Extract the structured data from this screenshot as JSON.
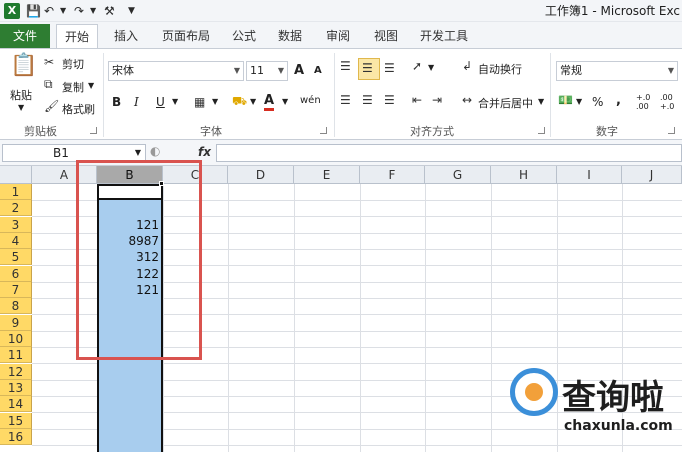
{
  "window": {
    "title": "工作簿1 - Microsoft Exc",
    "app_icon": "X"
  },
  "tabs": {
    "file": "文件",
    "items": [
      "开始",
      "插入",
      "页面布局",
      "公式",
      "数据",
      "审阅",
      "视图",
      "开发工具"
    ],
    "active": "开始"
  },
  "ribbon": {
    "clipboard": {
      "paste": "粘贴",
      "cut": "剪切",
      "copy": "复制",
      "format_painter": "格式刷",
      "group_label": "剪贴板"
    },
    "font": {
      "font_name": "宋体",
      "font_size": "11",
      "bold": "B",
      "italic": "I",
      "underline": "U",
      "grow": "A",
      "shrink": "A",
      "font_color": "A",
      "phonetic": "wén",
      "group_label": "字体"
    },
    "alignment": {
      "wrap_text": "自动换行",
      "merge_center": "合并后居中",
      "group_label": "对齐方式"
    },
    "number": {
      "format": "常规",
      "percent": "%",
      "comma": ",",
      "inc_decimal": "+.0 .00",
      "dec_decimal": ".00 +.0",
      "group_label": "数字"
    }
  },
  "formula_bar": {
    "name_box": "B1",
    "fx": "fx",
    "formula": ""
  },
  "sheet": {
    "columns": [
      "A",
      "B",
      "C",
      "D",
      "E",
      "F",
      "G",
      "H",
      "I",
      "J"
    ],
    "selected_column": "B",
    "rows": [
      "1",
      "2",
      "3",
      "4",
      "5",
      "6",
      "7",
      "8",
      "9",
      "10",
      "11",
      "12",
      "13",
      "14",
      "15",
      "16"
    ],
    "cells_b": [
      "",
      "",
      "121",
      "8987",
      "312",
      "122",
      "121",
      "",
      "",
      "",
      "",
      "",
      "",
      "",
      "",
      ""
    ]
  },
  "watermark": {
    "brand": "查询啦",
    "url": "chaxunla.com"
  },
  "colors": {
    "file_tab": "#2e7d32",
    "selection": "#a8cdee",
    "row_header": "#ffd966",
    "highlight_box": "#d9534f"
  }
}
